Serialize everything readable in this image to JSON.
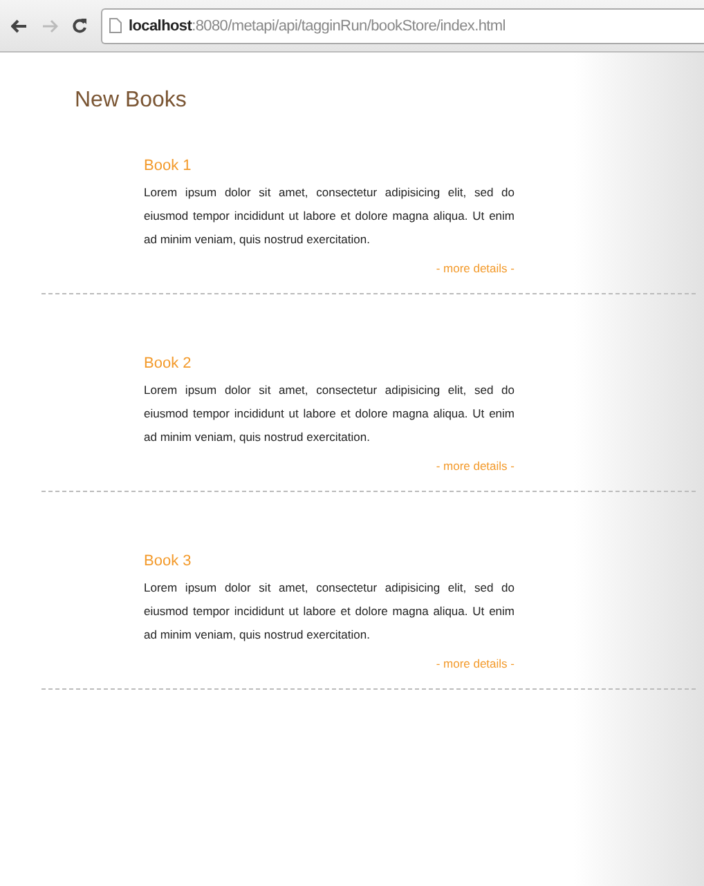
{
  "browser": {
    "url_host": "localhost",
    "url_path": ":8080/metapi/api/tagginRun/bookStore/index.html"
  },
  "heading": "New Books",
  "books": [
    {
      "title": "Book 1",
      "description": "Lorem ipsum dolor sit amet, consectetur adipisicing elit, sed do eiusmod tempor incididunt ut labore et dolore magna aliqua. Ut enim ad minim veniam, quis nostrud exercitation.",
      "link": "- more details -"
    },
    {
      "title": "Book 2",
      "description": "Lorem ipsum dolor sit amet, consectetur adipisicing elit, sed do eiusmod tempor incididunt ut labore et dolore magna aliqua. Ut enim ad minim veniam, quis nostrud exercitation.",
      "link": "- more details -"
    },
    {
      "title": "Book 3",
      "description": "Lorem ipsum dolor sit amet, consectetur adipisicing elit, sed do eiusmod tempor incididunt ut labore et dolore magna aliqua. Ut enim ad minim veniam, quis nostrud exercitation.",
      "link": "- more details -"
    }
  ]
}
